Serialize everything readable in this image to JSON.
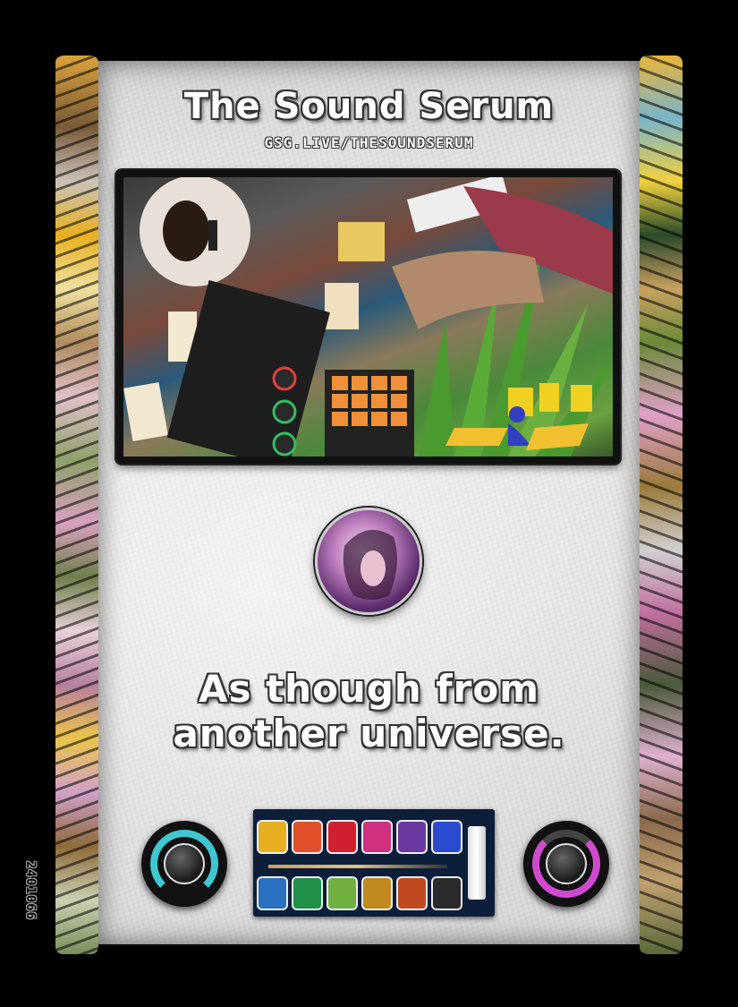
{
  "card": {
    "title": "The Sound Serum",
    "url": "GSG.LIVE/THESOUNDSERUM",
    "tagline_line1": "As though from",
    "tagline_line2": "another universe.",
    "serial": "2401066",
    "photo_description_icon": "studio-photo-icon",
    "avatar_icon": "artist-avatar-icon",
    "knob_left_color": "#3fc6d1",
    "knob_right_color": "#d04ad0",
    "palette_top_colors": [
      "#e8b020",
      "#e0502a",
      "#d02030",
      "#d03080",
      "#6a3aa0",
      "#2a4ad0"
    ],
    "palette_bottom_colors": [
      "#2a70c0",
      "#20904a",
      "#70b040",
      "#c08a20",
      "#c04a20",
      "#2a2a2a"
    ]
  }
}
